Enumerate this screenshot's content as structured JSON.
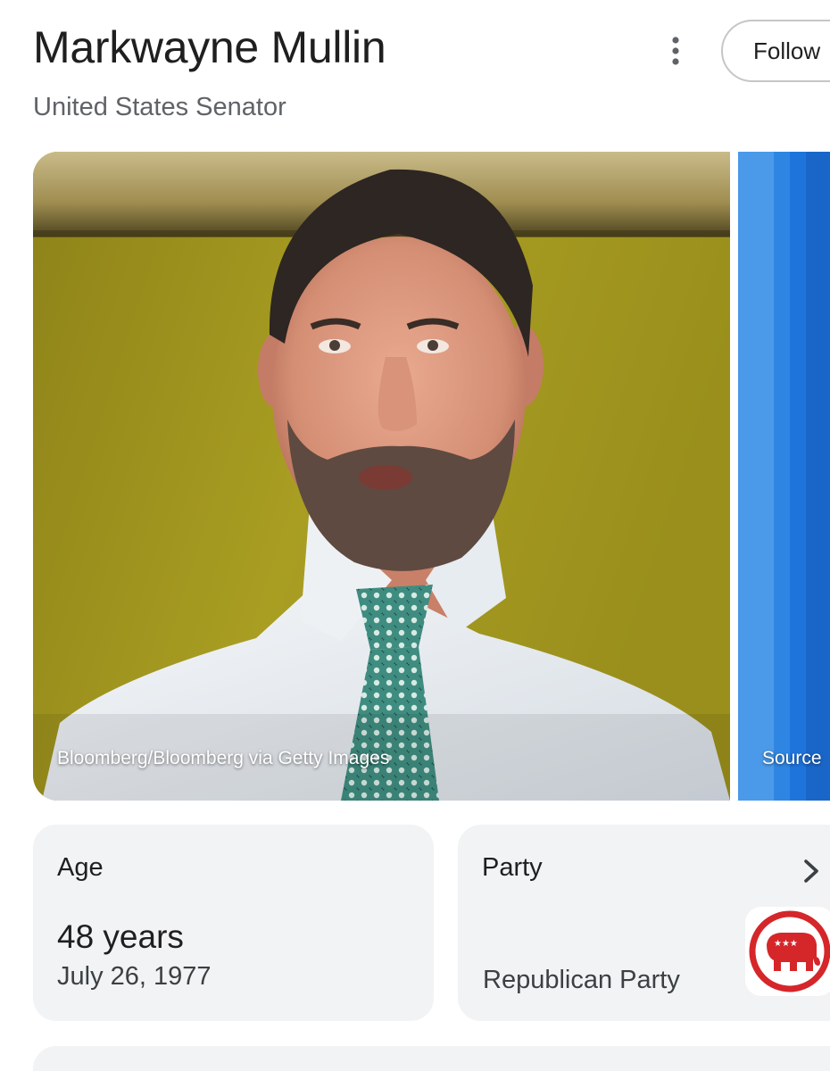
{
  "header": {
    "title": "Markwayne Mullin",
    "subtitle": "United States Senator",
    "follow_label": "Follow",
    "more_icon": "more-vert-icon"
  },
  "images": [
    {
      "credit": "Bloomberg/Bloomberg via Getty Images",
      "subject": "portrait-photo"
    },
    {
      "credit": "Source"
    }
  ],
  "facts": {
    "age": {
      "label": "Age",
      "value": "48 years",
      "detail": "July 26, 1977"
    },
    "party": {
      "label": "Party",
      "value": "Republican Party",
      "icon": "republican-elephant-icon",
      "chevron": "chevron-right-icon"
    }
  },
  "colors": {
    "accent_red": "#d5262a",
    "card_bg": "#f1f3f4",
    "photo_wall": "#a2981c",
    "photo_blue": "#1f74dc"
  }
}
